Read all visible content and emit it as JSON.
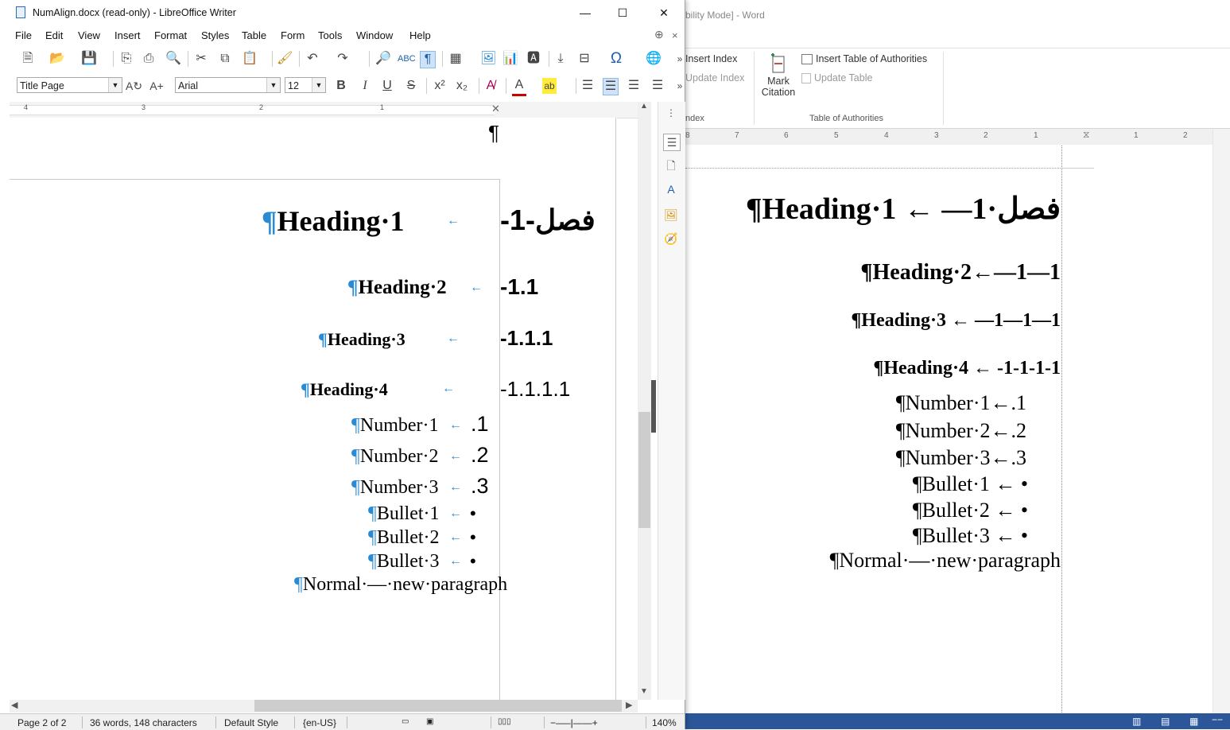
{
  "word": {
    "title_fragment": "bility Mode] - Word",
    "ribbon": {
      "insert_index": "Insert Index",
      "update_index": "Update Index",
      "index_group": "ndex",
      "mark_citation_line1": "Mark",
      "mark_citation_line2": "Citation",
      "insert_toa": "Insert Table of Authorities",
      "update_table": "Update Table",
      "toa_group": "Table of Authorities"
    },
    "ruler_numbers": [
      "8",
      "7",
      "6",
      "5",
      "4",
      "3",
      "2",
      "1",
      "1",
      "2"
    ],
    "document": {
      "heading1_arabic": "فصل",
      "heading1": "¶Heading·1 ← —1·",
      "heading2": "¶Heading·2←—1—1",
      "heading3": "¶Heading·3 ← —1—1—1",
      "heading4": "¶Heading·4 ← -1-1-1-1",
      "number1": "¶Number·1←.1",
      "number2": "¶Number·2←.2",
      "number3": "¶Number·3←.3",
      "bullet1": "¶Bullet·1 ← •",
      "bullet2": "¶Bullet·2 ← •",
      "bullet3": "¶Bullet·3 ← •",
      "normal": "¶Normal·—·new·paragraph"
    }
  },
  "writer": {
    "title": "NumAlign.docx (read-only) - LibreOffice Writer",
    "window_buttons": {
      "minimize": "—",
      "maximize": "☐",
      "close": "✕"
    },
    "menu": [
      "File",
      "Edit",
      "View",
      "Insert",
      "Format",
      "Styles",
      "Table",
      "Form",
      "Tools",
      "Window",
      "Help"
    ],
    "toolbar2": {
      "paragraph_style": "Title Page",
      "font_name": "Arial",
      "font_size": "12"
    },
    "ruler_numbers": [
      "4",
      "3",
      "2",
      "1"
    ],
    "document": {
      "top_pilcrow": "¶",
      "heading1_text": "Heading·1",
      "heading1_num_arabic": "فصل",
      "heading1_num": "-1-",
      "heading2_text": "Heading·2",
      "heading2_num": "-1.1",
      "heading3_text": "Heading·3",
      "heading3_num": "-1.1.1",
      "heading4_text": "Heading·4",
      "heading4_num": "-1.1.1.1",
      "number1_text": "Number·1",
      "number1_num": ".1",
      "number2_text": "Number·2",
      "number2_num": ".2",
      "number3_text": "Number·3",
      "number3_num": ".3",
      "bullet1_text": "Bullet·1",
      "bullet2_text": "Bullet·2",
      "bullet3_text": "Bullet·3",
      "bullet_symbol": "•",
      "normal_text": "Normal·—·new·paragraph",
      "pilcrow": "¶",
      "tab_arrow": "←"
    },
    "status": {
      "page": "Page 2 of 2",
      "words": "36 words, 148 characters",
      "style": "Default Style",
      "language": "{en-US}",
      "zoom": "140%"
    }
  }
}
